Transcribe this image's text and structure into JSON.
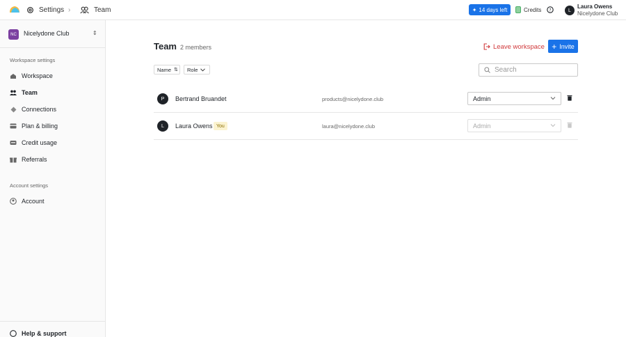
{
  "topbar": {
    "breadcrumb_settings": "Settings",
    "breadcrumb_team": "Team",
    "trial_label": "14 days left",
    "credits_label": "Credits",
    "user_name": "Laura Owens",
    "user_workspace": "Nicelydone Club",
    "user_initial": "L"
  },
  "sidebar": {
    "workspace_badge": "NC",
    "workspace_name": "Nicelydone Club",
    "section_workspace": "Workspace settings",
    "items": [
      {
        "label": "Workspace",
        "icon": "workspace-icon"
      },
      {
        "label": "Team",
        "icon": "team-icon"
      },
      {
        "label": "Connections",
        "icon": "connections-icon"
      },
      {
        "label": "Plan & billing",
        "icon": "billing-icon"
      },
      {
        "label": "Credit usage",
        "icon": "credit-usage-icon"
      },
      {
        "label": "Referrals",
        "icon": "referrals-icon"
      }
    ],
    "section_account": "Account settings",
    "account_item": "Account",
    "help_label": "Help & support"
  },
  "main": {
    "title": "Team",
    "member_count": "2 members",
    "leave_label": "Leave workspace",
    "invite_label": "Invite",
    "sort_name": "Name",
    "sort_role": "Role",
    "search_placeholder": "Search",
    "members": [
      {
        "initial": "P",
        "name": "Bertrand Bruandet",
        "email": "products@nicelydone.club",
        "role": "Admin",
        "you": ""
      },
      {
        "initial": "L",
        "name": "Laura Owens",
        "email": "laura@nicelydone.club",
        "role": "Admin",
        "you": "You"
      }
    ]
  },
  "colors": {
    "accent": "#1a73e8",
    "danger": "#d0393b",
    "workspace_badge": "#7b3fa0"
  }
}
